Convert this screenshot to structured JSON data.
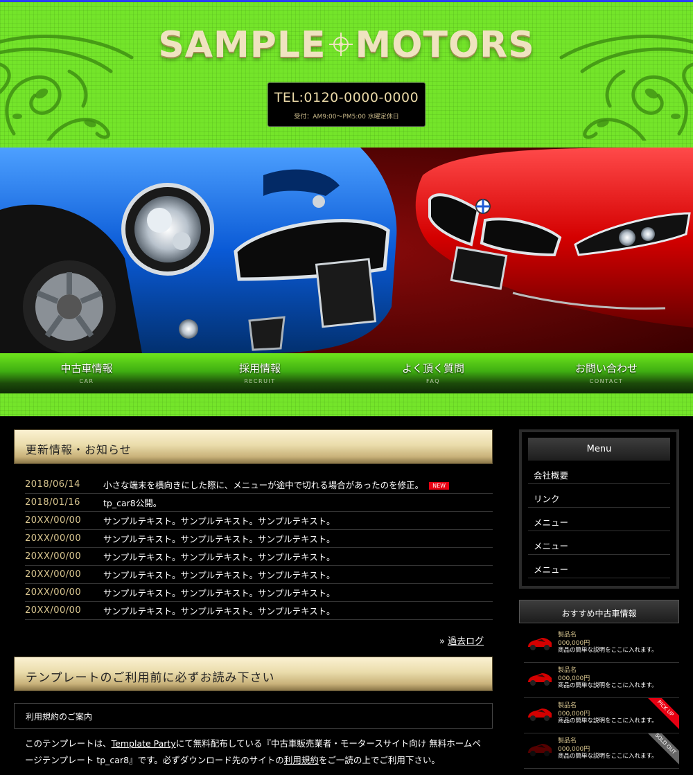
{
  "header": {
    "logo_left": "SAMPLE",
    "logo_right": "MOTORS",
    "tel": "TEL:0120-0000-0000",
    "hours": "受付：AM9:00〜PM5:00 水曜定休日"
  },
  "nav": [
    {
      "label": "中古車情報",
      "sub": "CAR"
    },
    {
      "label": "採用情報",
      "sub": "RECRUIT"
    },
    {
      "label": "よく頂く質問",
      "sub": "FAQ"
    },
    {
      "label": "お問い合わせ",
      "sub": "CONTACT"
    }
  ],
  "news": {
    "heading": "更新情報・お知らせ",
    "new_badge": "NEW",
    "items": [
      {
        "date": "2018/06/14",
        "text": "小さな端末を横向きにした際に、メニューが途中で切れる場合があったのを修正。"
      },
      {
        "date": "2018/01/16",
        "text": "tp_car8公開。"
      },
      {
        "date": "20XX/00/00",
        "text": "サンプルテキスト。サンプルテキスト。サンプルテキスト。"
      },
      {
        "date": "20XX/00/00",
        "text": "サンプルテキスト。サンプルテキスト。サンプルテキスト。"
      },
      {
        "date": "20XX/00/00",
        "text": "サンプルテキスト。サンプルテキスト。サンプルテキスト。"
      },
      {
        "date": "20XX/00/00",
        "text": "サンプルテキスト。サンプルテキスト。サンプルテキスト。"
      },
      {
        "date": "20XX/00/00",
        "text": "サンプルテキスト。サンプルテキスト。サンプルテキスト。"
      },
      {
        "date": "20XX/00/00",
        "text": "サンプルテキスト。サンプルテキスト。サンプルテキスト。"
      }
    ],
    "archive_prefix": "»",
    "archive_link": "過去ログ"
  },
  "notice": {
    "heading": "テンプレートのご利用前に必ずお読み下さい",
    "terms_box": "利用規約のご案内",
    "para_1": "このテンプレートは、",
    "link_tp": "Template Party",
    "para_2": "にて無料配布している『中古車販売業者・モータースサイト向け 無料ホームページテンプレート tp_car8』です。必ずダウンロード先のサイトの",
    "link_terms": "利用規約",
    "para_3": "をご一読の上でご利用下さい。"
  },
  "sidebar": {
    "menu_title": "Menu",
    "menu_items": [
      "会社概要",
      "リンク",
      "メニュー",
      "メニュー",
      "メニュー"
    ],
    "rec_title": "おすすめ中古車情報",
    "rec_items": [
      {
        "name": "製品名",
        "price": "000,000円",
        "desc": "商品の簡単な説明をここに入れます。",
        "ribbon": ""
      },
      {
        "name": "製品名",
        "price": "000,000円",
        "desc": "商品の簡単な説明をここに入れます。",
        "ribbon": ""
      },
      {
        "name": "製品名",
        "price": "000,000円",
        "desc": "商品の簡単な説明をここに入れます。",
        "ribbon": "PICK UP"
      },
      {
        "name": "製品名",
        "price": "000,000円",
        "desc": "商品の簡単な説明をここに入れます。",
        "ribbon": "SOLD OUT"
      }
    ]
  },
  "colors": {
    "header_green": "#74e52a",
    "gold_text": "#d9c690",
    "new_red": "#e60012",
    "top_border_blue": "#2a3cff"
  }
}
